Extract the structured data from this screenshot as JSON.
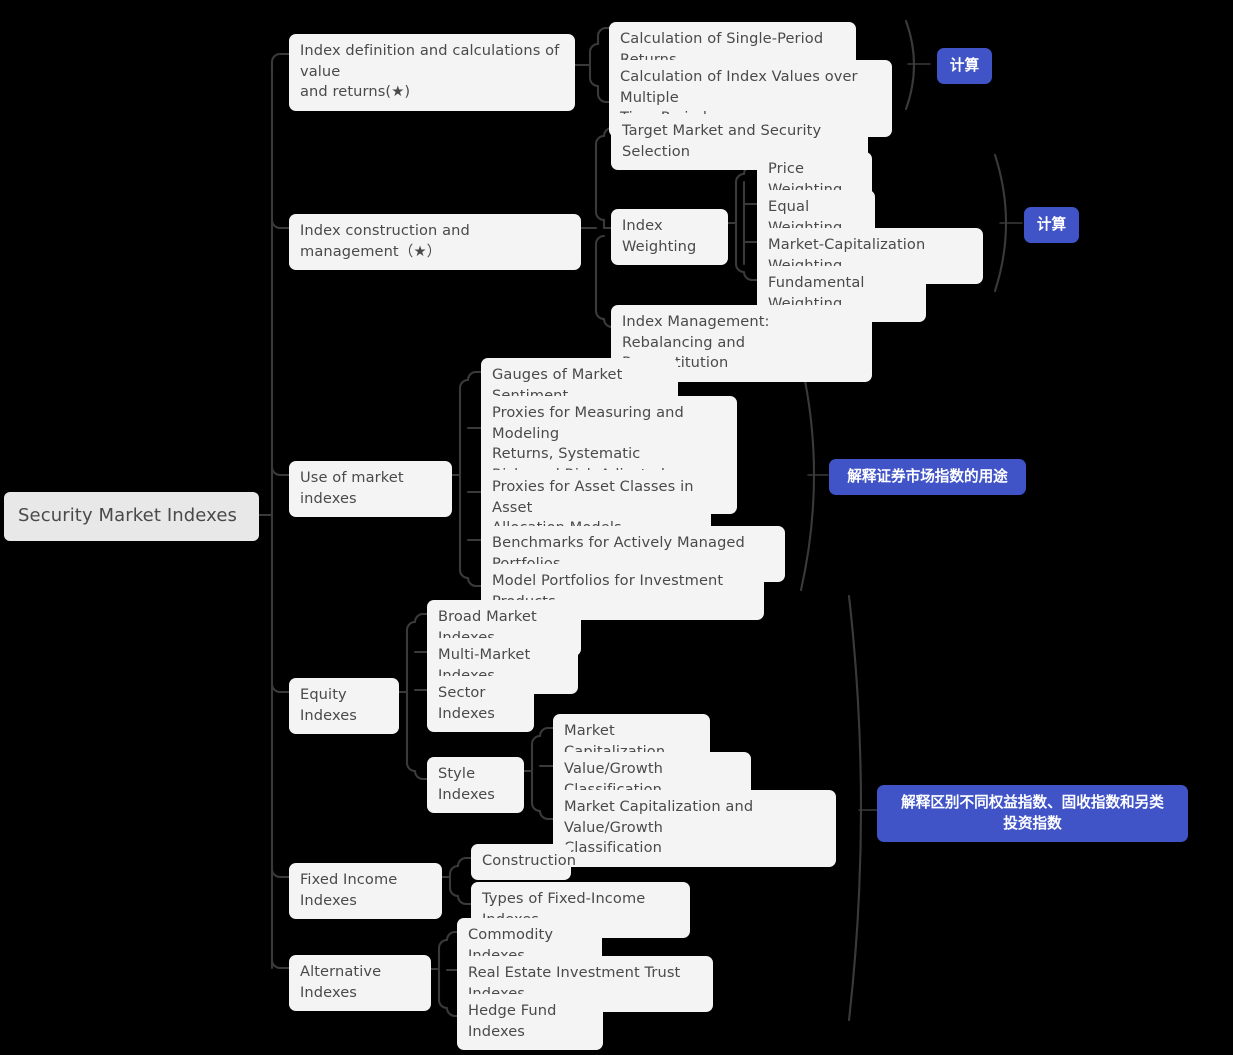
{
  "diagram": {
    "title": "Security Market Indexes",
    "type": "mindmap",
    "background_color": "#000000",
    "node_color": "#f4f4f4",
    "root_node_color": "#e8e8e8",
    "node_text_color": "#4a4a4a",
    "badge_color": "#4054c7",
    "badge_text_color": "#ffffff",
    "edge_color": "#3a3a3a"
  },
  "root": {
    "label": "Security Market Indexes"
  },
  "branches": [
    {
      "id": "index-definition",
      "label": "Index definition and calculations of value\nand returns(★)",
      "children": [
        {
          "id": "single-period-returns",
          "label": "Calculation of Single-Period Returns"
        },
        {
          "id": "index-values-multiple-periods",
          "label": "Calculation of Index Values over Multiple\nTime Periods"
        }
      ]
    },
    {
      "id": "index-construction",
      "label": "Index construction and management（★）",
      "children": [
        {
          "id": "target-market-security-selection",
          "label": "Target Market and Security Selection"
        },
        {
          "id": "index-weighting",
          "label": "Index Weighting",
          "children": [
            {
              "id": "price-weighting",
              "label": "Price Weighting"
            },
            {
              "id": "equal-weighting",
              "label": "Equal Weighting"
            },
            {
              "id": "market-cap-weighting",
              "label": "Market-Capitalization Weighting"
            },
            {
              "id": "fundamental-weighting",
              "label": "Fundamental Weighting"
            }
          ]
        },
        {
          "id": "index-management",
          "label": "Index Management: Rebalancing and\nReconstitution"
        }
      ]
    },
    {
      "id": "use-of-market-indexes",
      "label": "Use of market indexes",
      "children": [
        {
          "id": "gauges-market-sentiment",
          "label": "Gauges of Market Sentiment"
        },
        {
          "id": "proxies-measuring-modeling",
          "label": "Proxies for Measuring and Modeling\nReturns, Systematic\nRisk, and Risk-Adjusted Performance"
        },
        {
          "id": "proxies-asset-classes",
          "label": "Proxies for Asset Classes in Asset\nAllocation Models"
        },
        {
          "id": "benchmarks-actively-managed",
          "label": "Benchmarks for Actively Managed Portfolios"
        },
        {
          "id": "model-portfolios",
          "label": "Model Portfolios for Investment Products"
        }
      ]
    },
    {
      "id": "equity-indexes",
      "label": "Equity Indexes",
      "children": [
        {
          "id": "broad-market-indexes",
          "label": "Broad Market Indexes"
        },
        {
          "id": "multi-market-indexes",
          "label": "Multi-Market Indexes"
        },
        {
          "id": "sector-indexes",
          "label": "Sector Indexes"
        },
        {
          "id": "style-indexes",
          "label": "Style Indexes",
          "children": [
            {
              "id": "market-capitalization",
              "label": "Market Capitalization"
            },
            {
              "id": "value-growth-classification",
              "label": "Value/Growth Classification"
            },
            {
              "id": "market-cap-and-value-growth",
              "label": "Market Capitalization and Value/Growth\nClassification"
            }
          ]
        }
      ]
    },
    {
      "id": "fixed-income-indexes",
      "label": "Fixed Income Indexes",
      "children": [
        {
          "id": "construction",
          "label": "Construction"
        },
        {
          "id": "types-fixed-income-indexes",
          "label": "Types of Fixed-Income Indexes"
        }
      ]
    },
    {
      "id": "alternative-indexes",
      "label": "Alternative Indexes",
      "children": [
        {
          "id": "commodity-indexes",
          "label": "Commodity Indexes"
        },
        {
          "id": "reit-indexes",
          "label": "Real Estate Investment Trust Indexes"
        },
        {
          "id": "hedge-fund-indexes",
          "label": "Hedge Fund Indexes"
        }
      ]
    }
  ],
  "badges": [
    {
      "id": "badge-calculation-top",
      "label": "计算"
    },
    {
      "id": "badge-calculation-weighting",
      "label": "计算"
    },
    {
      "id": "badge-use-of-indexes",
      "label": "解释证券市场指数的用途"
    },
    {
      "id": "badge-distinguish-indexes",
      "label": "解释区别不同权益指数、固收指数和另类\n投资指数"
    }
  ]
}
